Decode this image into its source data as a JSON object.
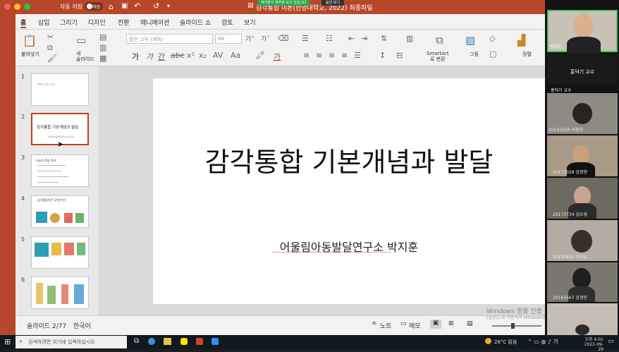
{
  "app": {
    "autosave_label": "자동 저장",
    "autosave_state": "꺼짐",
    "doc_title": "감각통합 이론(한양대학교, 2022) 최종파일",
    "share_banner": "박지훈의 화면을 보고 있습니다",
    "view_option": "옵션 보기",
    "accent": "#b7472a"
  },
  "ribbon": {
    "tabs": [
      "홈",
      "삽입",
      "그리기",
      "디자인",
      "전환",
      "애니메이션",
      "슬라이드 쇼",
      "검토",
      "보기"
    ],
    "paste_label": "붙여넣기",
    "new_slide_label": "새\n슬라이드",
    "font_name": "맑은 고딕 (제목)",
    "font_size": "66",
    "smartart_label": "SmartArt\n로 변환",
    "picture_label": "그림",
    "arrange_label": "정렬"
  },
  "thumbnails": [
    {
      "num": "1",
      "text": "발표자 및 소개"
    },
    {
      "num": "2",
      "text": "감각통합 기본개념과 발달",
      "sub": "어울림아동발달연구소 박지훈"
    },
    {
      "num": "3",
      "text": "오늘의 학습 목차"
    },
    {
      "num": "4",
      "text": "감각통합이란 무엇인가?"
    },
    {
      "num": "5",
      "text": ""
    },
    {
      "num": "6",
      "text": ""
    }
  ],
  "slide": {
    "title": "감각통합 기본개념과 발달",
    "subtitle": "어울림아동발달연구소  박지훈"
  },
  "status": {
    "slide_counter": "슬라이드 2/77",
    "language": "한국어",
    "notes_label": "노트",
    "comments_label": "메모",
    "activate": "Windows 정품 인증",
    "activate_sub": "[설정]으로 이동하여 Windows를 정품 인증합니다."
  },
  "taskbar": {
    "search_placeholder": "검색하려면 여기에 입력하십시오",
    "weather": "26°C 맑음",
    "time": "오후 4:01",
    "date": "2022-09-29"
  },
  "participants": [
    {
      "name": "박지훈"
    },
    {
      "name": "홍덕기 교수"
    },
    {
      "name": "홍덕기 교수"
    },
    {
      "name": "20193526 이정지"
    },
    {
      "name": "20173028 임정현"
    },
    {
      "name": "20173734 김소영"
    },
    {
      "name": "20193825 이하늘"
    },
    {
      "name": "20163567 강경민"
    },
    {
      "name": ""
    }
  ]
}
